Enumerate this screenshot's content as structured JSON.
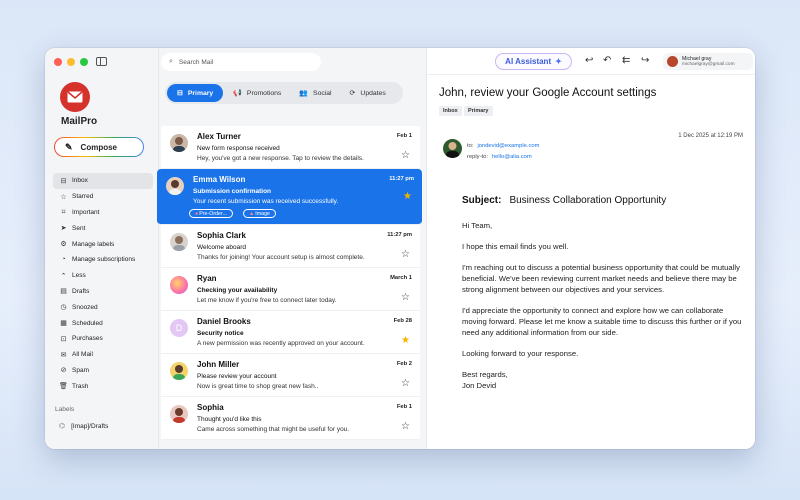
{
  "app": {
    "name": "MailPro",
    "compose_label": "Compose"
  },
  "search": {
    "placeholder": "Search Mail"
  },
  "sidebar": {
    "items": [
      {
        "icon": "inbox-icon",
        "label": "Inbox",
        "active": true
      },
      {
        "icon": "star-icon",
        "label": "Starred"
      },
      {
        "icon": "bookmark-icon",
        "label": "Important"
      },
      {
        "icon": "send-icon",
        "label": "Sent"
      },
      {
        "icon": "gear-icon",
        "label": "Manage labels"
      },
      {
        "icon": "rss-icon",
        "label": "Manage subscriptions"
      },
      {
        "icon": "chevron-up-icon",
        "label": "Less"
      },
      {
        "icon": "draft-icon",
        "label": "Drafts"
      },
      {
        "icon": "clock-icon",
        "label": "Snoozed"
      },
      {
        "icon": "calendar-icon",
        "label": "Scheduled"
      },
      {
        "icon": "cart-icon",
        "label": "Purchases"
      },
      {
        "icon": "mail-icon",
        "label": "All Mail"
      },
      {
        "icon": "warning-icon",
        "label": "Spam"
      },
      {
        "icon": "trash-icon",
        "label": "Trash"
      }
    ],
    "labels_title": "Labels",
    "labels": [
      {
        "label": "[Imap]/Drafts"
      }
    ]
  },
  "tabs": [
    {
      "label": "Primary",
      "active": true
    },
    {
      "label": "Promotions"
    },
    {
      "label": "Social"
    },
    {
      "label": "Updates"
    }
  ],
  "mails": [
    {
      "sender": "Alex Turner",
      "time": "Feb 1",
      "subject": "New form response received",
      "preview": "Hey, you've got a new response. Tap to review the details.",
      "starred": false
    },
    {
      "sender": "Emma Wilson",
      "time": "11:27 pm",
      "subject": "Submission confirmation",
      "preview": "Your recent submission was received successfully.",
      "starred": true,
      "selected": true,
      "attachments": [
        "Pre-Order...",
        "Image"
      ]
    },
    {
      "sender": "Sophia Clark",
      "time": "11:27 pm",
      "subject": "Welcome aboard",
      "preview": "Thanks for joining! Your account setup is almost complete.",
      "starred": false
    },
    {
      "sender": "Ryan",
      "time": "March 1",
      "subject": "Checking your availability",
      "preview": "Let me know if you're free to connect later today.",
      "starred": false
    },
    {
      "sender": "Daniel Brooks",
      "time": "Feb 28",
      "subject": "Security notice",
      "preview": "A new permission was recently approved on your account.",
      "starred": true,
      "avatar_letter": "D"
    },
    {
      "sender": "John Miller",
      "time": "Feb 2",
      "subject": "Please review your account",
      "preview": "Now is great time to shop great new fash..",
      "starred": false
    },
    {
      "sender": "Sophia",
      "time": "Feb 1",
      "subject": "Thought you'd like this",
      "preview": "Came across something that might be useful for you.",
      "starred": false
    }
  ],
  "reader": {
    "ai_label": "AI Assistant",
    "user_name": "Michael gray",
    "user_email": "michaelgray@gmail.com",
    "title": "John, review your Google Account settings",
    "chips": [
      "Inbox",
      "Primary"
    ],
    "date": "1 Dec 2025 at 12:19 PM",
    "to_label": "to:",
    "to": "jondevid@example.com",
    "reply_label": "reply-to:",
    "reply_to": "hello@alia.com",
    "subject_label": "Subject:",
    "subject": "Business Collaboration Opportunity",
    "body": [
      "Hi Team,",
      "I hope this email finds you well.",
      "I'm reaching out to discuss a potential business opportunity that could be mutually beneficial. We've been reviewing current market needs and believe there may be strong alignment between our objectives and your services.",
      "I'd appreciate the opportunity to connect and explore how we can collaborate moving forward. Please let me know a suitable time to discuss this further or if you need any additional information from our side.",
      "Looking forward to your response.",
      "Best regards,\nJon Devid"
    ]
  },
  "colors": {
    "accent": "#1a73e8",
    "logo": "#d6322c",
    "star": "#f4b400"
  }
}
